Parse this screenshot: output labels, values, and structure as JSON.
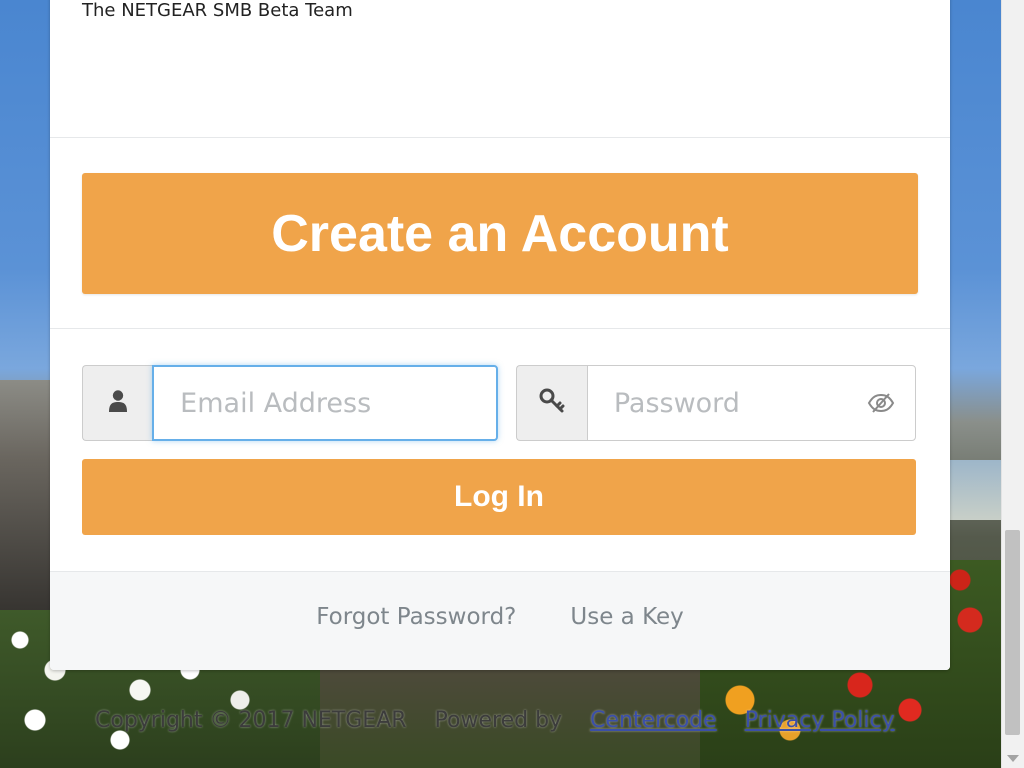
{
  "signature": "The NETGEAR SMB Beta Team",
  "create_account_label": "Create an Account",
  "login_form": {
    "email_placeholder": "Email Address",
    "password_placeholder": "Password",
    "login_label": "Log In"
  },
  "footer_links": {
    "forgot_password": "Forgot Password?",
    "use_key": "Use a Key"
  },
  "copyright": {
    "text": "Copyright © 2017 NETGEAR",
    "powered_by": "Powered by",
    "centercode": "Centercode",
    "privacy": "Privacy Policy"
  },
  "icons": {
    "user": "user-icon",
    "key": "key-icon",
    "eye": "eye-slash-icon"
  },
  "colors": {
    "accent": "#f0a44a",
    "focus": "#66afe9",
    "link": "#3b4fa8"
  }
}
